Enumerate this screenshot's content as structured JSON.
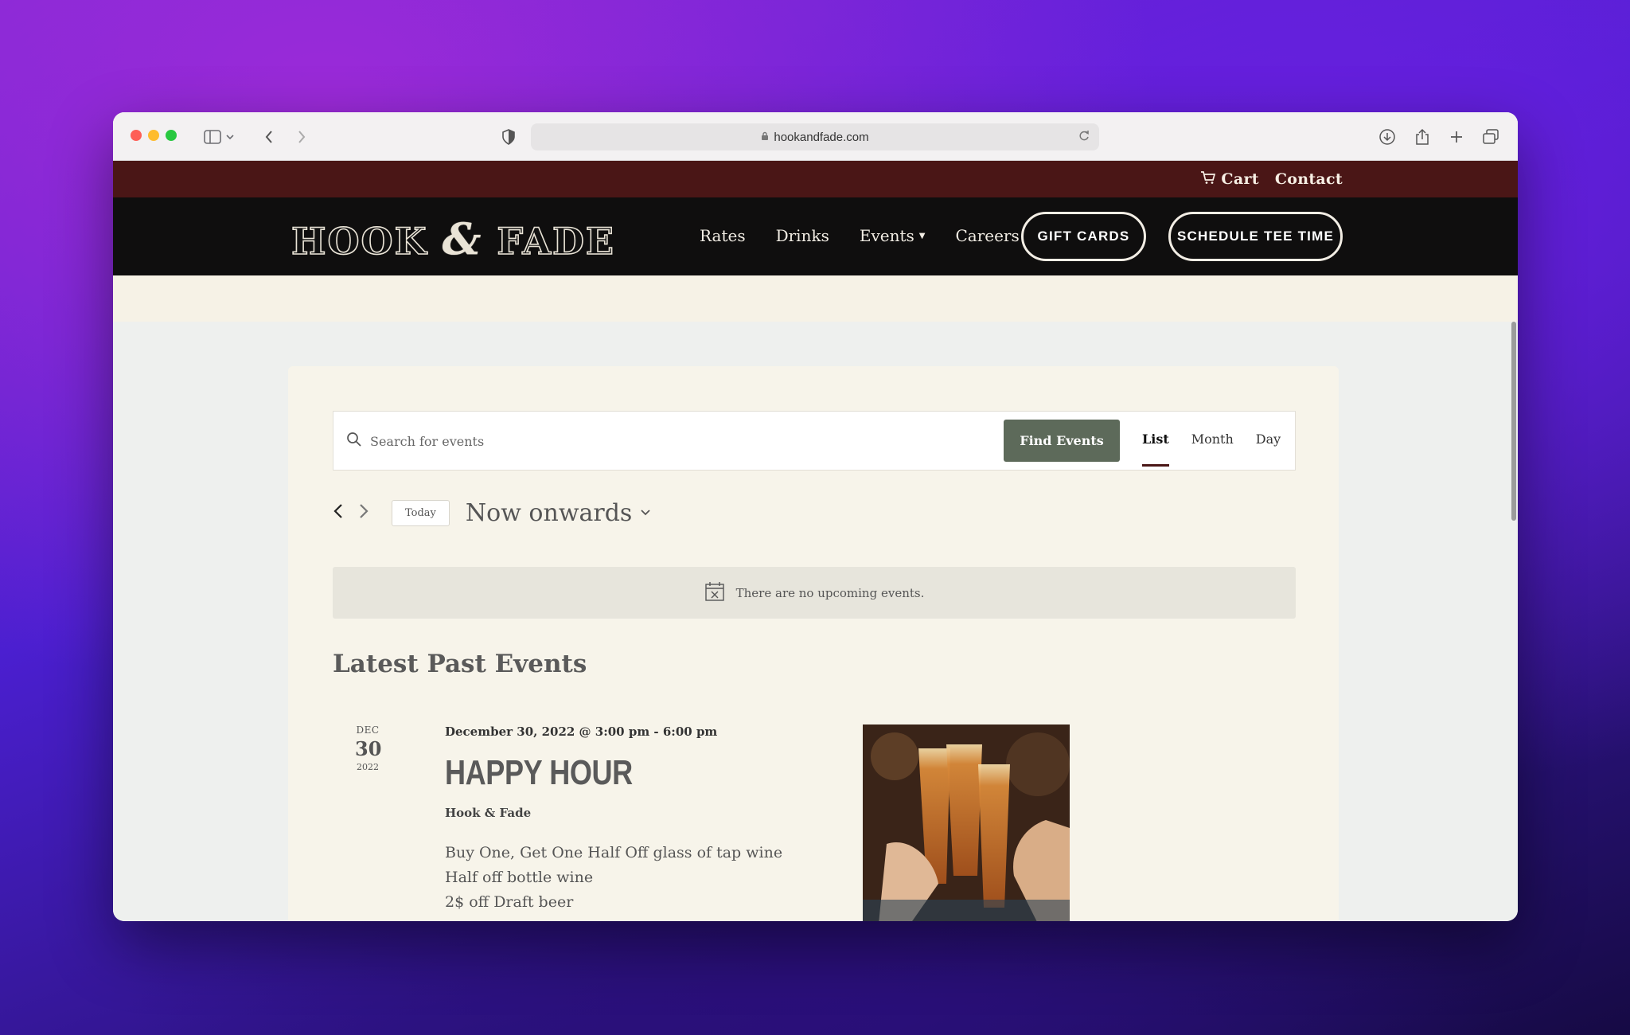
{
  "browser": {
    "url": "hookandfade.com"
  },
  "topbar": {
    "cart": "Cart",
    "contact": "Contact"
  },
  "nav": {
    "logo": "HOOK & FADE",
    "links": [
      "Rates",
      "Drinks",
      "Events",
      "Careers"
    ],
    "gift_cards": "GIFT CARDS",
    "schedule": "SCHEDULE TEE TIME"
  },
  "search": {
    "placeholder": "Search for events",
    "button": "Find Events",
    "views": [
      "List",
      "Month",
      "Day"
    ],
    "active_view": "List"
  },
  "date_nav": {
    "today": "Today",
    "range": "Now onwards"
  },
  "notice": "There are no upcoming events.",
  "past": {
    "title": "Latest Past Events",
    "event": {
      "month": "DEC",
      "day": "30",
      "year": "2022",
      "when": "December 30, 2022 @ 3:00 pm - 6:00 pm",
      "title": "HAPPY HOUR",
      "venue": "Hook & Fade",
      "desc": [
        "Buy One, Get One Half Off glass of tap wine",
        "Half off bottle wine",
        "2$ off Draft beer"
      ]
    }
  },
  "colors": {
    "topbar": "#4a1616",
    "nav": "#0f0e0e",
    "accent_button": "#5d6a5a"
  }
}
